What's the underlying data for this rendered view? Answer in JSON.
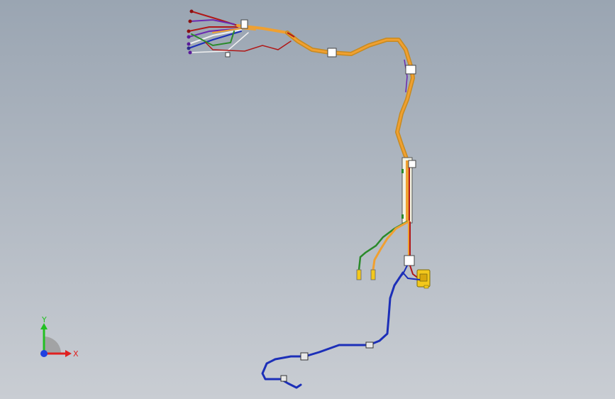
{
  "viewport": {
    "background_top": "#9aa5b2",
    "background_bottom": "#c9cdd3"
  },
  "triad": {
    "x_label": "X",
    "y_label": "Y",
    "x_color": "#e02020",
    "y_color": "#22c022",
    "z_color": "#2040e0"
  },
  "wire_colors": {
    "orange": "#f0a030",
    "red": "#b01818",
    "blue": "#1c2fb8",
    "green": "#2a8a2a",
    "purple": "#6a2ab0",
    "white": "#f0f0f0",
    "yellow_connector": "#f3c81c"
  }
}
